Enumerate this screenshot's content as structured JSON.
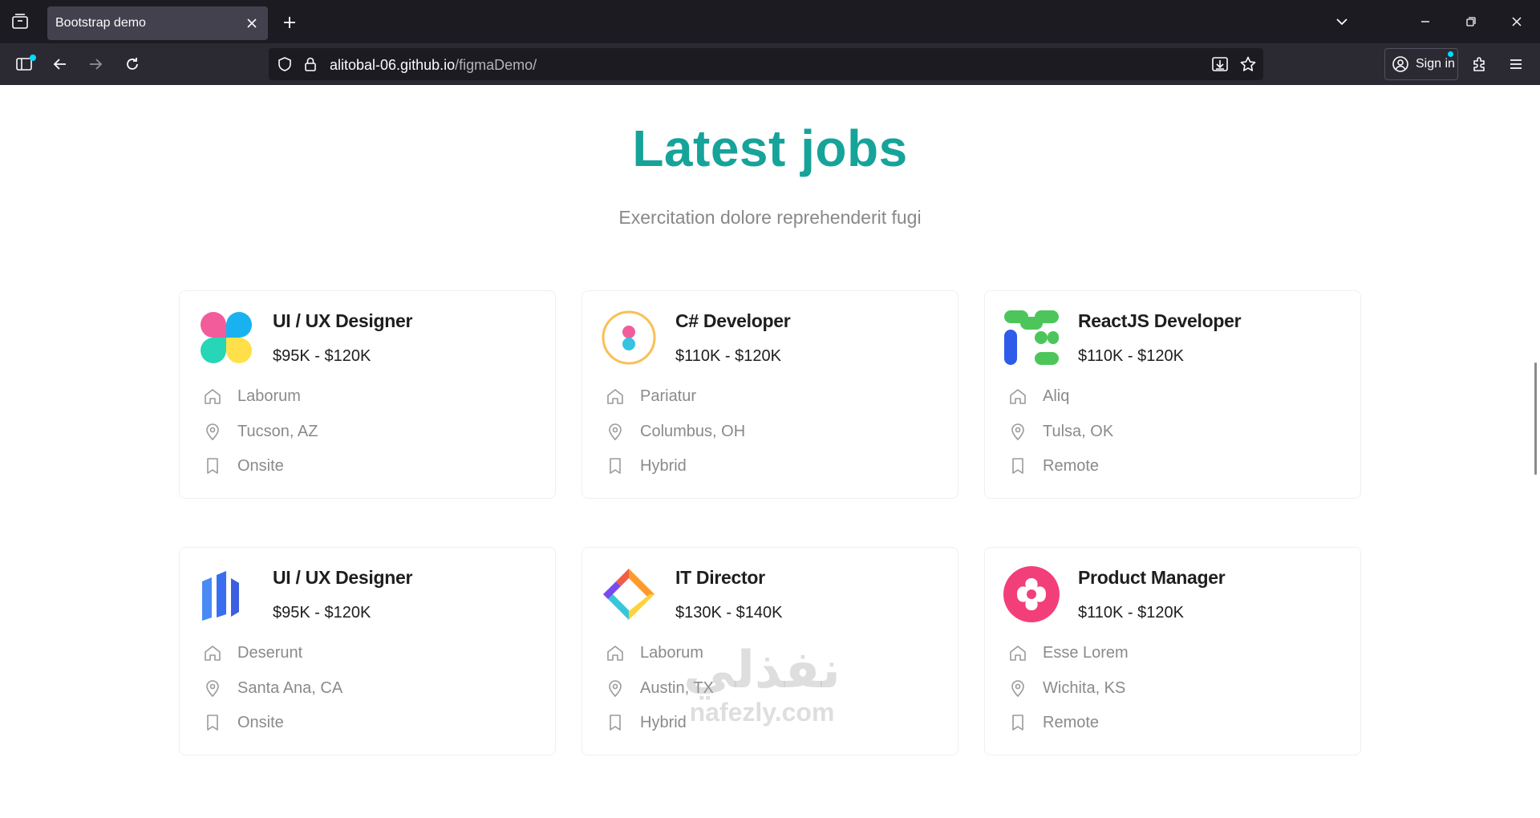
{
  "browser": {
    "tab_title": "Bootstrap demo",
    "url_host": "alitobal-06.github.io",
    "url_path": "/figmaDemo/",
    "signin_label": "Sign in"
  },
  "page": {
    "heading": "Latest jobs",
    "subheading": "Exercitation dolore reprehenderit fugi"
  },
  "jobs": [
    {
      "title": "UI / UX Designer",
      "salary": "$95K - $120K",
      "company": "Laborum",
      "location": "Tucson, AZ",
      "type": "Onsite",
      "logo": "petals-logo-icon"
    },
    {
      "title": "C# Developer",
      "salary": "$110K - $120K",
      "company": "Pariatur",
      "location": "Columbus, OH",
      "type": "Hybrid",
      "logo": "ring-dots-logo-icon"
    },
    {
      "title": "ReactJS Developer",
      "salary": "$110K - $120K",
      "company": "Aliq",
      "location": "Tulsa, OK",
      "type": "Remote",
      "logo": "green-pills-logo-icon"
    },
    {
      "title": "UI / UX Designer",
      "salary": "$95K - $120K",
      "company": "Deserunt",
      "location": "Santa Ana, CA",
      "type": "Onsite",
      "logo": "blue-bars-logo-icon"
    },
    {
      "title": "IT Director",
      "salary": "$130K - $140K",
      "company": "Laborum",
      "location": "Austin, TX",
      "type": "Hybrid",
      "logo": "rainbow-diamond-logo-icon"
    },
    {
      "title": "Product Manager",
      "salary": "$110K - $120K",
      "company": "Esse Lorem",
      "location": "Wichita, KS",
      "type": "Remote",
      "logo": "pink-flower-logo-icon"
    }
  ],
  "watermark": {
    "arabic": "نفذلي",
    "latin": "nafezly.com"
  },
  "colors": {
    "accent": "#16a39a",
    "muted": "#8a8a8a",
    "chrome_dark": "#1c1b22",
    "chrome": "#2b2a33"
  }
}
